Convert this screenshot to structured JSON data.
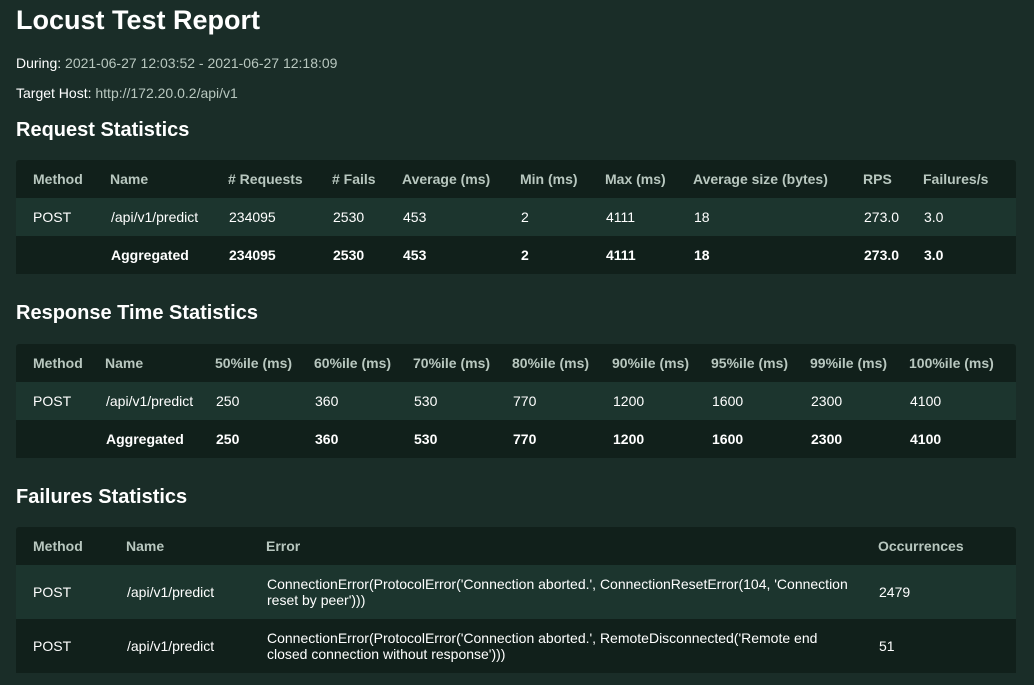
{
  "title": "Locust Test Report",
  "during": {
    "label": "During:",
    "value": "2021-06-27 12:03:52 - 2021-06-27 12:18:09"
  },
  "target_host": {
    "label": "Target Host:",
    "value": "http://172.20.0.2/api/v1"
  },
  "request_stats": {
    "heading": "Request Statistics",
    "columns": [
      "Method",
      "Name",
      "# Requests",
      "# Fails",
      "Average (ms)",
      "Min (ms)",
      "Max (ms)",
      "Average size (bytes)",
      "RPS",
      "Failures/s"
    ],
    "rows": [
      [
        "POST",
        "/api/v1/predict",
        "234095",
        "2530",
        "453",
        "2",
        "4111",
        "18",
        "273.0",
        "3.0"
      ],
      [
        "",
        "Aggregated",
        "234095",
        "2530",
        "453",
        "2",
        "4111",
        "18",
        "273.0",
        "3.0"
      ]
    ]
  },
  "response_stats": {
    "heading": "Response Time Statistics",
    "columns": [
      "Method",
      "Name",
      "50%ile (ms)",
      "60%ile (ms)",
      "70%ile (ms)",
      "80%ile (ms)",
      "90%ile (ms)",
      "95%ile (ms)",
      "99%ile (ms)",
      "100%ile (ms)"
    ],
    "rows": [
      [
        "POST",
        "/api/v1/predict",
        "250",
        "360",
        "530",
        "770",
        "1200",
        "1600",
        "2300",
        "4100"
      ],
      [
        "",
        "Aggregated",
        "250",
        "360",
        "530",
        "770",
        "1200",
        "1600",
        "2300",
        "4100"
      ]
    ]
  },
  "failure_stats": {
    "heading": "Failures Statistics",
    "columns": [
      "Method",
      "Name",
      "Error",
      "Occurrences"
    ],
    "rows": [
      [
        "POST",
        "/api/v1/predict",
        "ConnectionError(ProtocolError('Connection aborted.', ConnectionResetError(104, 'Connection reset by peer')))",
        "2479"
      ],
      [
        "POST",
        "/api/v1/predict",
        "ConnectionError(ProtocolError('Connection aborted.', RemoteDisconnected('Remote end closed connection without response')))",
        "51"
      ]
    ]
  }
}
